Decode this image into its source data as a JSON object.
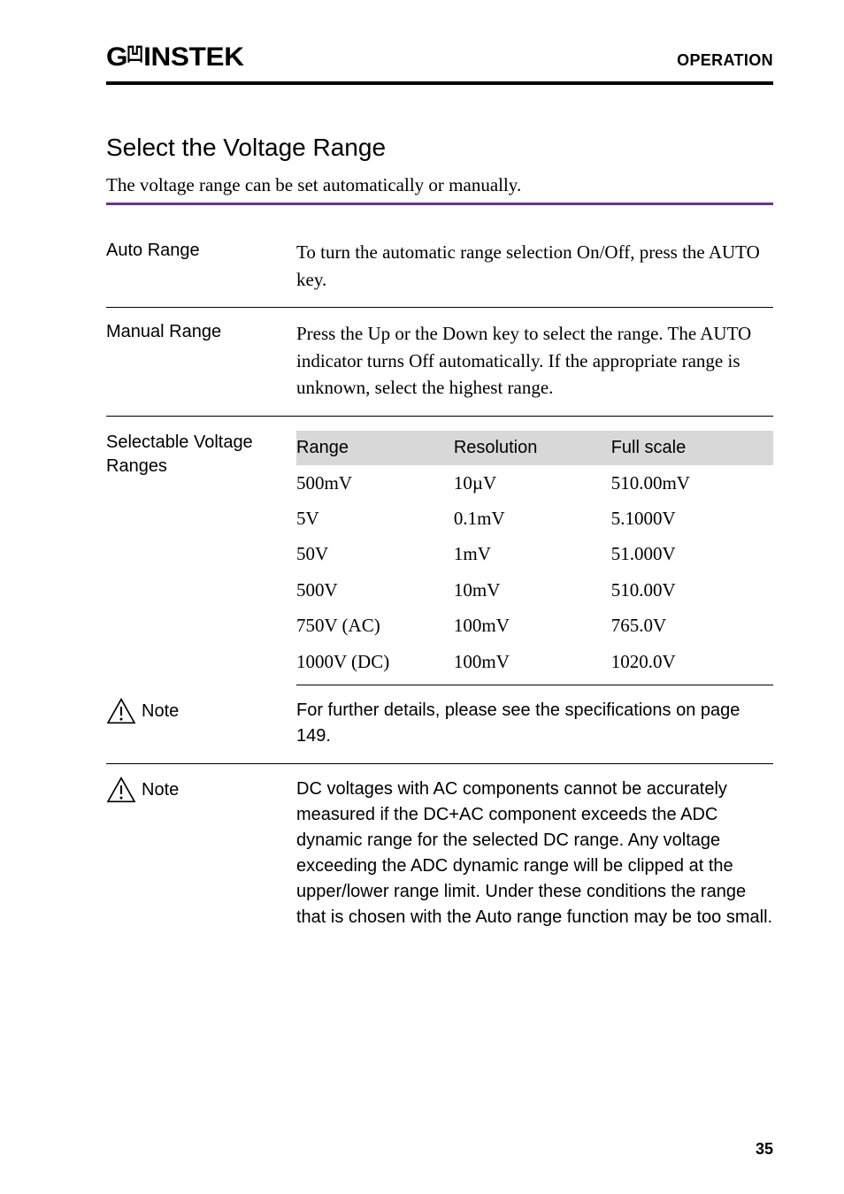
{
  "header": {
    "brand_left": "G",
    "brand_right": "INSTEK",
    "section": "OPERATION"
  },
  "title": "Select the Voltage Range",
  "intro": "The voltage range can be set automatically or manually.",
  "rows": {
    "auto": {
      "label": "Auto Range",
      "text": "To turn the automatic range selection On/Off, press the AUTO key."
    },
    "manual": {
      "label": "Manual Range",
      "text": "Press the Up or the Down key to select the range. The AUTO indicator turns Off automatically. If the appropriate range is unknown, select the highest range."
    },
    "selectable": {
      "label": "Selectable Voltage Ranges",
      "headers": {
        "range": "Range",
        "resolution": "Resolution",
        "fullscale": "Full scale"
      },
      "data": [
        {
          "range": "500mV",
          "resolution": "10µV",
          "fullscale": "510.00mV"
        },
        {
          "range": "5V",
          "resolution": "0.1mV",
          "fullscale": "5.1000V"
        },
        {
          "range": "50V",
          "resolution": "1mV",
          "fullscale": "51.000V"
        },
        {
          "range": "500V",
          "resolution": "10mV",
          "fullscale": "510.00V"
        },
        {
          "range": "750V (AC)",
          "resolution": "100mV",
          "fullscale": "765.0V"
        },
        {
          "range": "1000V (DC)",
          "resolution": "100mV",
          "fullscale": "1020.0V"
        }
      ]
    },
    "note1": {
      "label": "Note",
      "text": "For further details, please see the specifications on page 149."
    },
    "note2": {
      "label": "Note",
      "text": "DC voltages with AC components cannot be accurately measured if the DC+AC component exceeds the ADC dynamic range for the selected DC range. Any voltage exceeding the ADC dynamic range will be clipped at the upper/lower range limit. Under these conditions the range that is chosen with the Auto range function may be too small."
    }
  },
  "chart_data": {
    "type": "table",
    "title": "Selectable Voltage Ranges",
    "columns": [
      "Range",
      "Resolution",
      "Full scale"
    ],
    "rows": [
      [
        "500mV",
        "10µV",
        "510.00mV"
      ],
      [
        "5V",
        "0.1mV",
        "5.1000V"
      ],
      [
        "50V",
        "1mV",
        "51.000V"
      ],
      [
        "500V",
        "10mV",
        "510.00V"
      ],
      [
        "750V (AC)",
        "100mV",
        "765.0V"
      ],
      [
        "1000V (DC)",
        "100mV",
        "1020.0V"
      ]
    ]
  },
  "page_number": "35"
}
